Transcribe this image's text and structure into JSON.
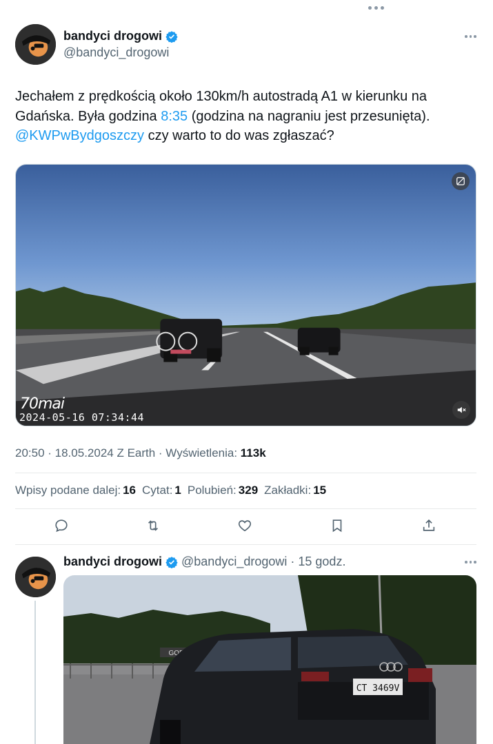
{
  "colors": {
    "accent": "#1d9bf0",
    "text": "#0f1419",
    "muted": "#536471",
    "divider": "#e7e9ea"
  },
  "tweet": {
    "author_name": "bandyci drogowi",
    "author_handle": "@bandyci_drogowi",
    "text_part1": "Jechałem z prędkością około 130km/h autostradą A1 w kierunku na Gdańska. Była godzina ",
    "time_link": "8:35",
    "text_part2": " (godzina na nagraniu jest przesunięta). ",
    "mention": "@KWPwBydgoszczy",
    "text_part3": " czy warto to do was zgłaszać?",
    "video": {
      "brand": "70mai",
      "timestamp": "2024-05-16  07:34:44"
    },
    "meta_time": "20:50 · 18.05.2024 Z Earth · Wyświetlenia: ",
    "views": "113k",
    "stats": [
      {
        "label": "Wpisy podane dalej:",
        "value": "16"
      },
      {
        "label": "Cytat:",
        "value": "1"
      },
      {
        "label": "Polubień:",
        "value": "329"
      },
      {
        "label": "Zakładki:",
        "value": "15"
      }
    ],
    "actions": [
      "reply-icon",
      "retweet-icon",
      "like-icon",
      "bookmark-icon",
      "share-icon"
    ]
  },
  "reply": {
    "author_name": "bandyci drogowi",
    "author_handle": "@bandyci_drogowi",
    "age": "· 15 godz.",
    "sign_text": "GORAL",
    "plate": "CT 3469V"
  }
}
